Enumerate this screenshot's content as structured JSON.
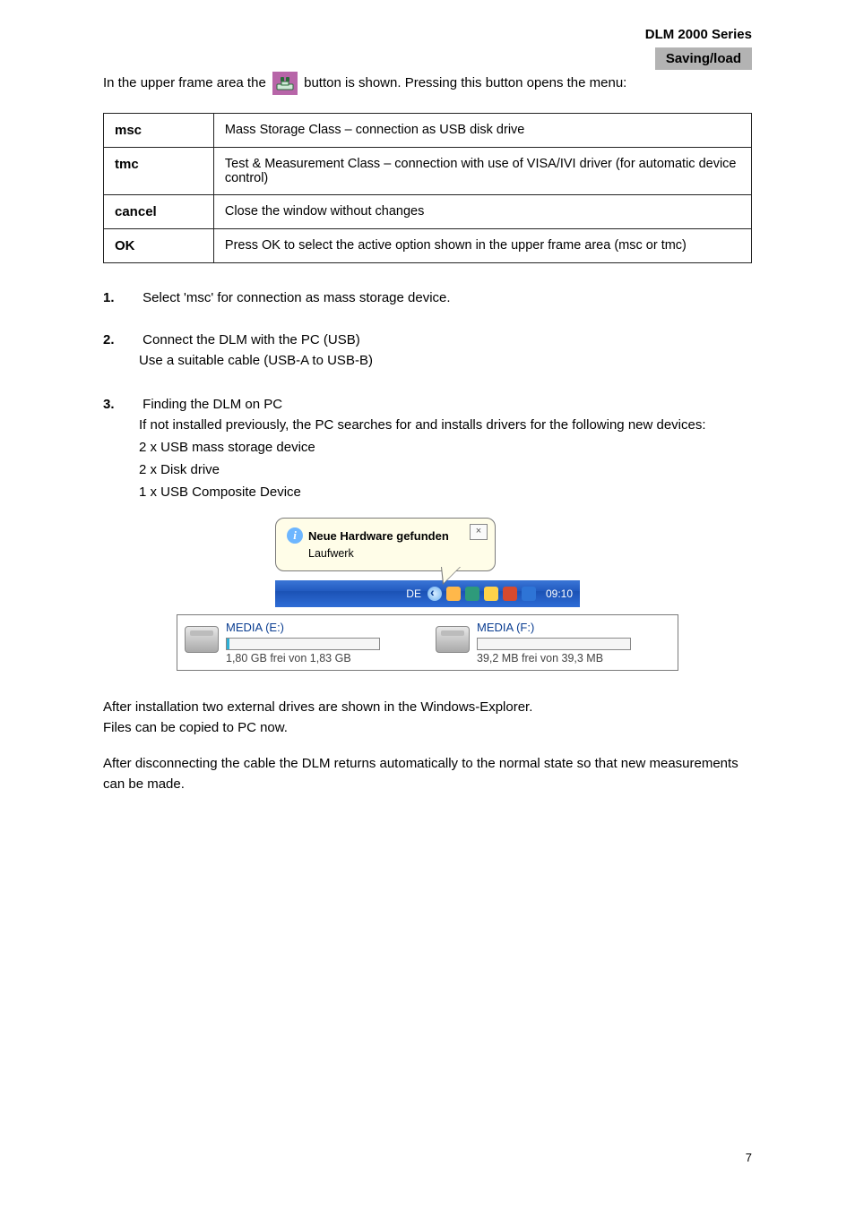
{
  "header": {
    "line1": "DLM 2000 Series",
    "line2": "Saving/load"
  },
  "intro_text_before_icon": "In the upper frame area the ",
  "intro_text_after_icon": " button is shown. Pressing this button opens the menu:",
  "table": {
    "rows": [
      {
        "label": "msc",
        "desc": "Mass Storage Class – connection as USB disk drive"
      },
      {
        "label": "tmc",
        "desc": "Test & Measurement Class – connection with use of VISA/IVI driver (for automatic device control)"
      },
      {
        "label": "cancel",
        "desc": "Close the window without changes"
      },
      {
        "label": "OK",
        "desc": "Press OK to select the active option shown in the upper frame area (msc or tmc)"
      }
    ]
  },
  "steps": {
    "s1": {
      "num": "1.",
      "text": "Select 'msc' for connection as mass storage device."
    },
    "s2": {
      "num": "2.",
      "text1": "Connect the DLM with the PC (USB)",
      "text2": "Use a suitable cable (USB-A to USB-B)"
    },
    "s3": {
      "num": "3.",
      "text1": "Finding the DLM on PC",
      "text2": "If not installed previously, the PC searches for and installs drivers for the following new devices:",
      "bullets": [
        "2 x USB mass storage device",
        "2 x Disk drive",
        "1 x USB Composite Device"
      ]
    }
  },
  "balloon": {
    "title": "Neue Hardware gefunden",
    "subtitle": "Laufwerk"
  },
  "taskbar": {
    "lang": "DE",
    "clock": "09:10"
  },
  "drives": {
    "e": {
      "name": "MEDIA (E:)",
      "free": "1,80 GB frei von 1,83 GB",
      "fill_pct": "2%"
    },
    "f": {
      "name": "MEDIA (F:)",
      "free": "39,2 MB frei von 39,3 MB",
      "fill_pct": "0%"
    }
  },
  "footer_lines": [
    "After installation two external drives are shown in the Windows-Explorer.",
    "Files can be copied to PC now.",
    "After disconnecting the cable the DLM returns automatically to the normal state so that new measurements can be made."
  ],
  "page_number": "7"
}
